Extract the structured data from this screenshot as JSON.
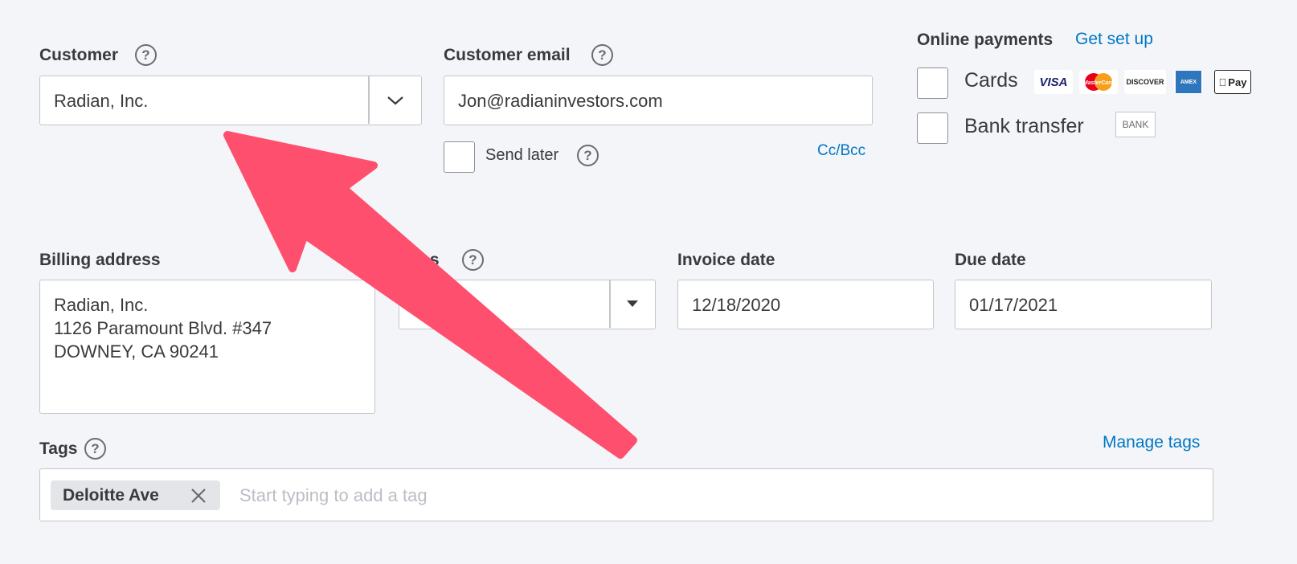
{
  "customer": {
    "label": "Customer",
    "help_icon": "?",
    "value": "Radian, Inc."
  },
  "customer_email": {
    "label": "Customer email",
    "help_icon": "?",
    "value": "Jon@radianinvestors.com",
    "send_later_label": "Send later",
    "cc_bcc_label": "Cc/Bcc"
  },
  "online_payments": {
    "label": "Online payments",
    "setup_link": "Get set up",
    "cards_label": "Cards",
    "bank_label": "Bank transfer",
    "card_brands": [
      "VISA",
      "MasterCard",
      "DISCOVER",
      "AMEX",
      "Pay"
    ],
    "bank_badge": "BANK"
  },
  "billing_address": {
    "label": "Billing address",
    "lines": [
      "Radian, Inc.",
      "1126 Paramount Blvd. #347",
      "DOWNEY, CA  90241"
    ]
  },
  "terms": {
    "label": "rms",
    "help_icon": "?",
    "value": "N"
  },
  "invoice_date": {
    "label": "Invoice date",
    "value": "12/18/2020"
  },
  "due_date": {
    "label": "Due date",
    "value": "01/17/2021"
  },
  "tags": {
    "label": "Tags",
    "help_icon": "?",
    "manage_link": "Manage tags",
    "chips": [
      "Deloitte Ave"
    ],
    "placeholder": "Start typing to add a tag"
  },
  "colors": {
    "background": "#f4f5f8",
    "link": "#0077c5",
    "annotation_arrow": "#ff4f6e"
  }
}
